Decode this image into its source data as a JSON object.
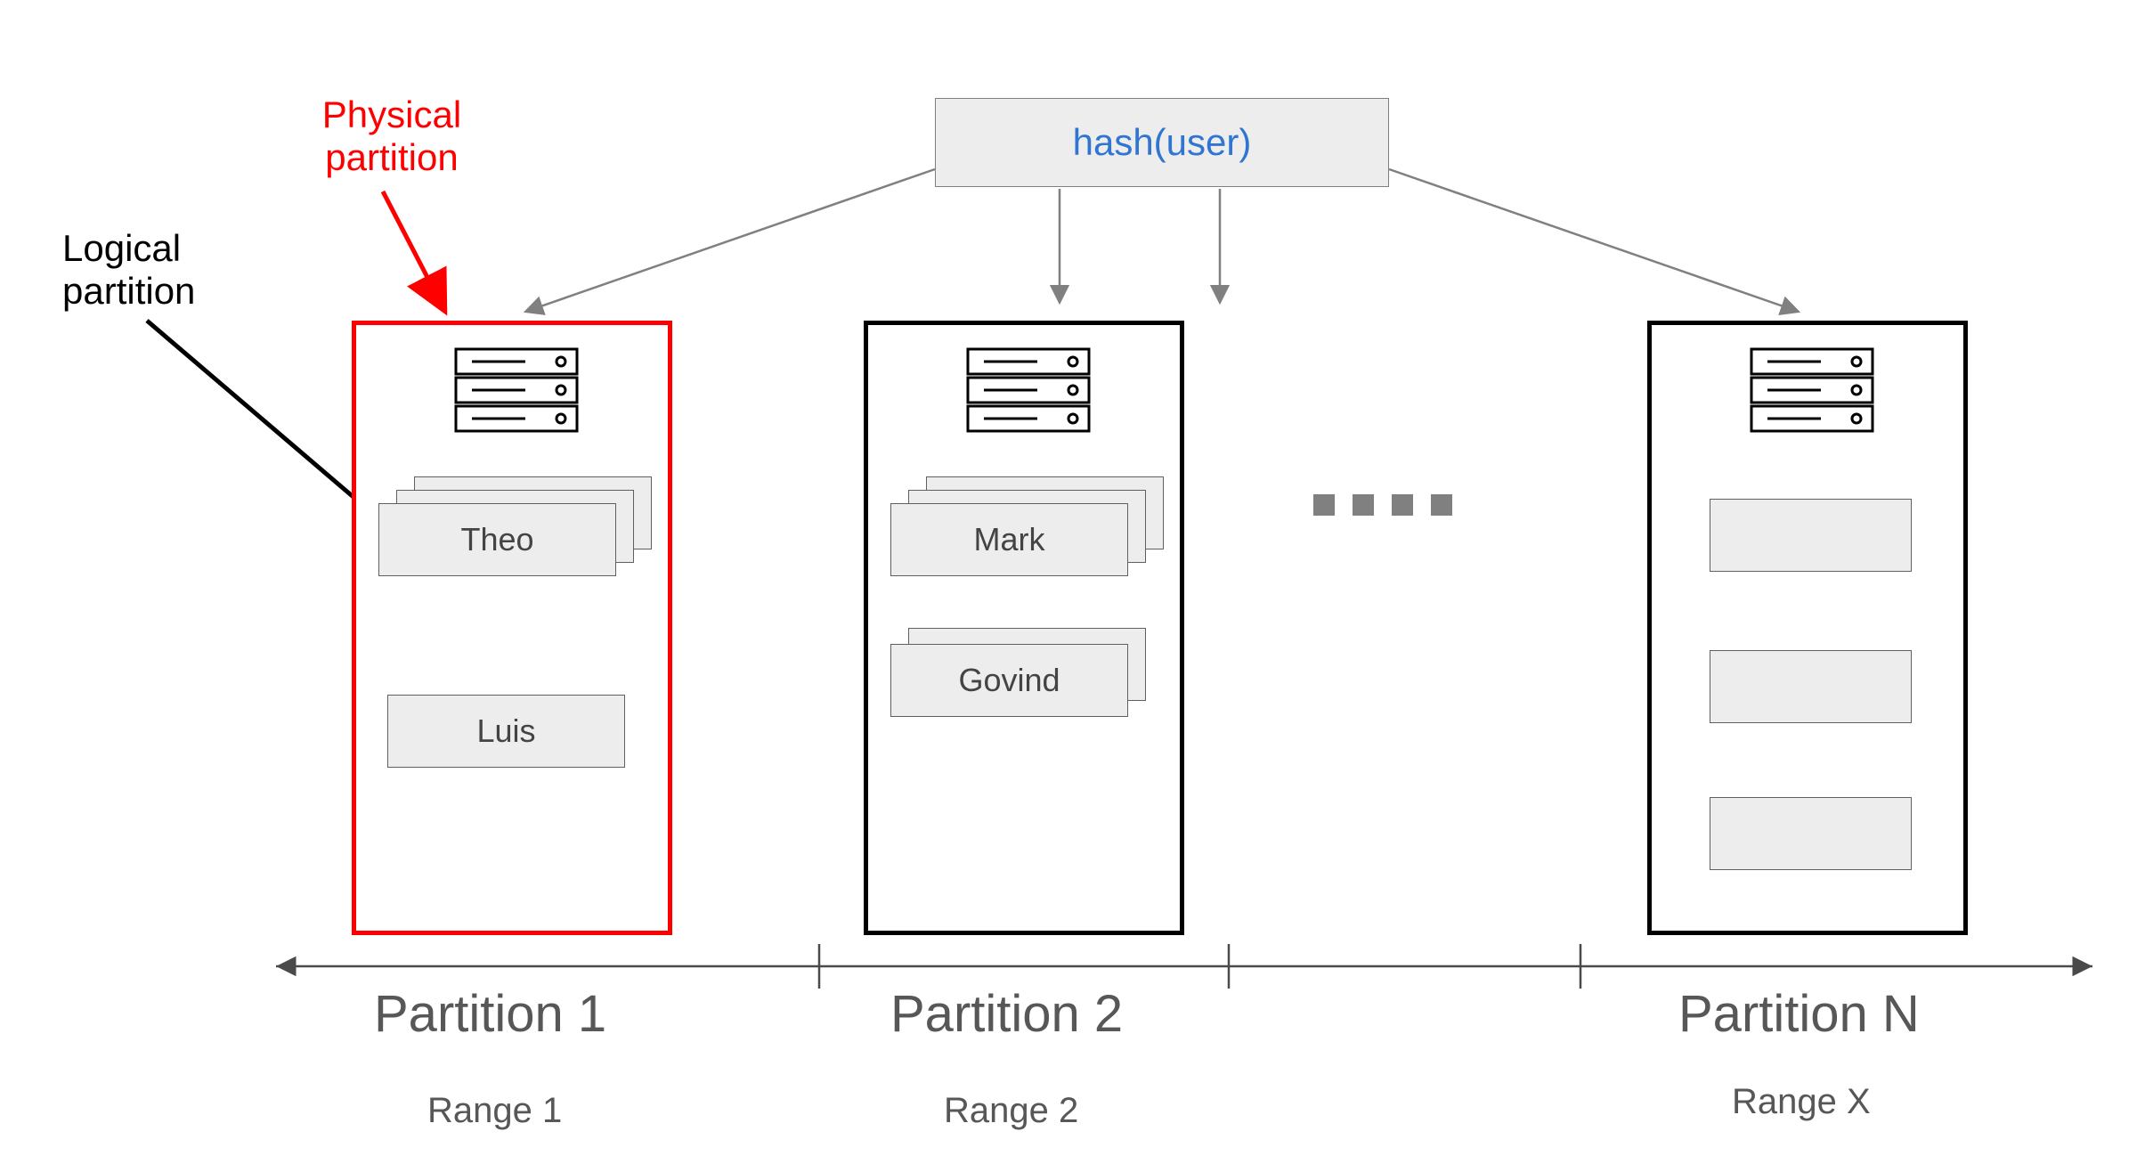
{
  "hash": {
    "label": "hash(user)"
  },
  "annotations": {
    "physical_partition": "Physical\npartition",
    "logical_partition": "Logical\npartition"
  },
  "partitions": {
    "p1": {
      "title": "Partition 1",
      "range": "Range 1",
      "cards": {
        "theo": "Theo",
        "luis": "Luis"
      }
    },
    "p2": {
      "title": "Partition 2",
      "range": "Range 2",
      "cards": {
        "mark": "Mark",
        "govind": "Govind"
      }
    },
    "pn": {
      "title": "Partition N",
      "range": "Range X"
    }
  },
  "ellipsis": "…"
}
